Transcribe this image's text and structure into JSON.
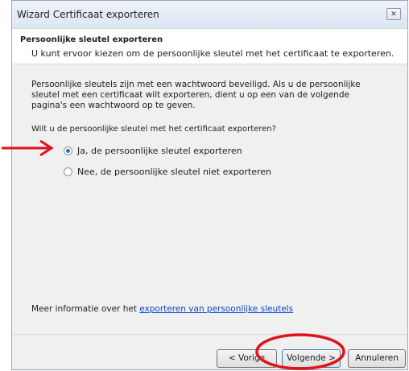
{
  "window": {
    "title": "Wizard Certificaat exporteren",
    "close_label": "✕"
  },
  "header": {
    "title": "Persoonlijke sleutel exporteren",
    "description": "U kunt ervoor kiezen om de persoonlijke sleutel met het certificaat te exporteren."
  },
  "body": {
    "paragraph": "Persoonlijke sleutels zijn met een wachtwoord beveiligd. Als u de persoonlijke sleutel met een certificaat wilt exporteren, dient u op een van de volgende pagina's een wachtwoord op te geven.",
    "question": "Wilt u de persoonlijke sleutel met het certificaat exporteren?",
    "options": [
      {
        "label": "Ja, de persoonlijke sleutel exporteren",
        "checked": true
      },
      {
        "label": "Nee, de persoonlijke sleutel niet exporteren",
        "checked": false
      }
    ],
    "more_info_prefix": "Meer informatie over het ",
    "more_info_link": "exporteren van persoonlijke sleutels"
  },
  "footer": {
    "prev_label": "< Vorige",
    "next_label": "Volgende >",
    "cancel_label": "Annuleren"
  },
  "annotations": {
    "arrow_color": "#e0121b",
    "circle_color": "#e0121b"
  }
}
